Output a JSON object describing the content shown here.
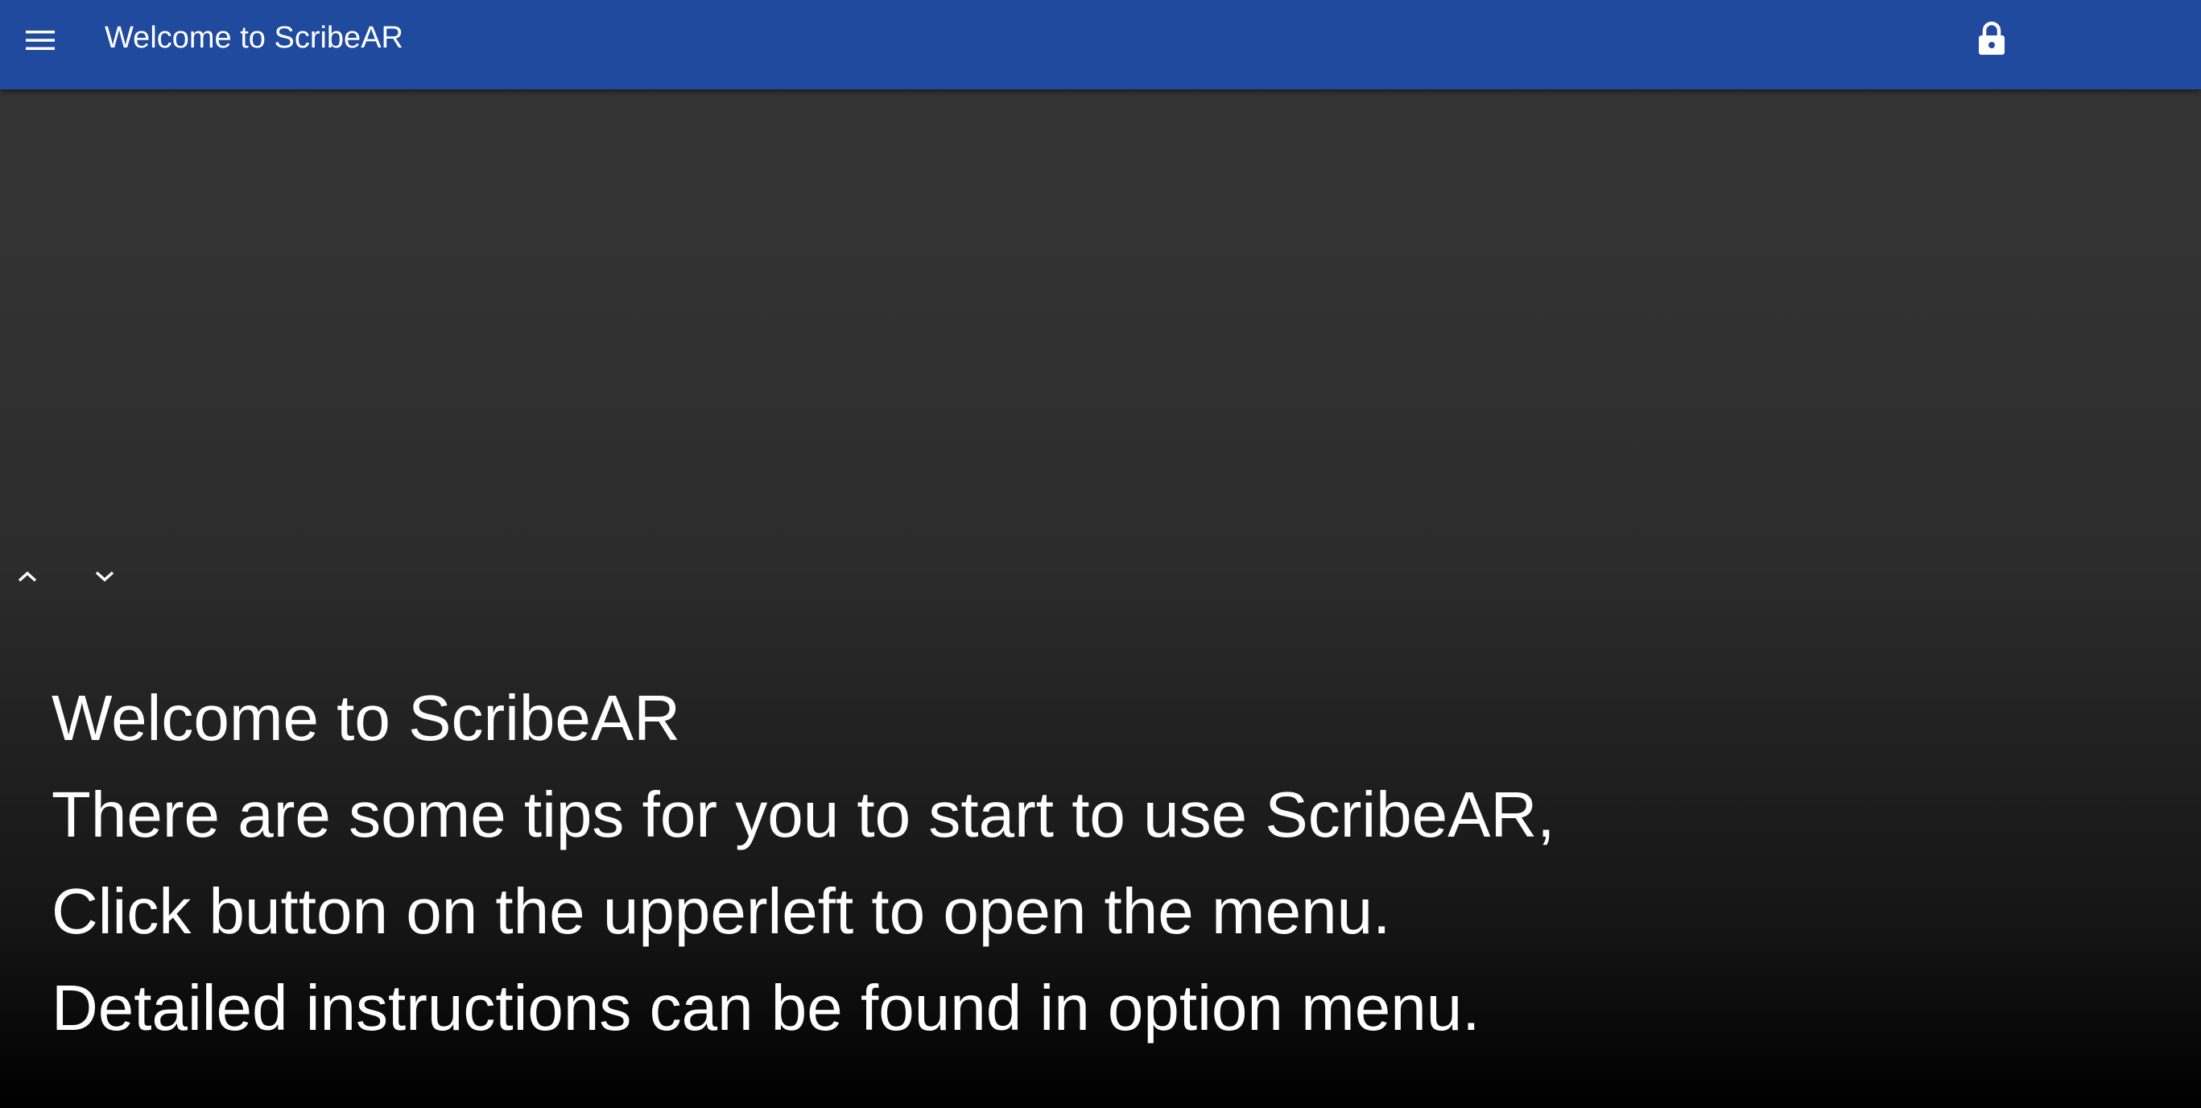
{
  "app_bar": {
    "title": "Welcome to ScribeAR",
    "background_color": "#1f4a9e",
    "menu_icon": "menu-icon",
    "lock_icon": "lock-icon"
  },
  "scroll_controls": {
    "up_icon": "chevron-up-icon",
    "down_icon": "chevron-down-icon"
  },
  "captions": {
    "lines": [
      "Welcome to ScribeAR",
      "There are some tips for you to start to use ScribeAR,",
      "Click button on the upperleft to open the menu.",
      "Detailed instructions can be found in option menu."
    ],
    "text_color": "#ffffff"
  }
}
